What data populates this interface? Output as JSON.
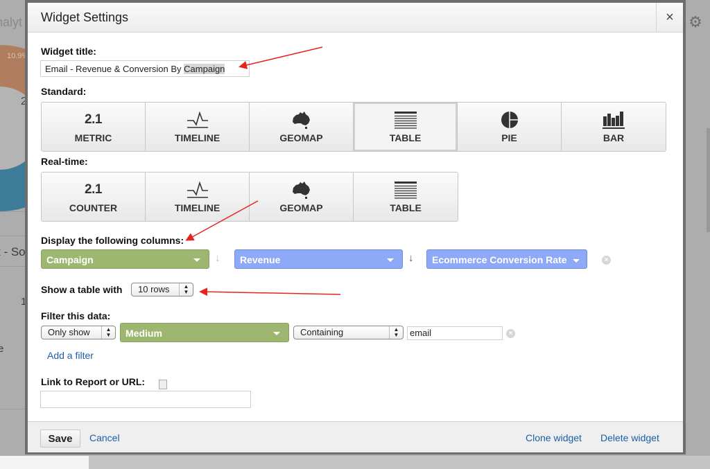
{
  "background": {
    "title_fragment": "nalyt",
    "pie_percent_label": "10.9%",
    "pie_center_fragment": "2",
    "row_text_fragment": "t - So",
    "row_value_fragment": "1",
    "row_text_fragment2": "e",
    "gear_icon": "gear-icon"
  },
  "modal": {
    "title": "Widget Settings",
    "close_icon": "×",
    "widget_title_label": "Widget title:",
    "widget_title_value_prefix": "Email - Revenue & Conversion By ",
    "widget_title_value_highlight": "Campaign",
    "standard_label": "Standard:",
    "standard_options": [
      {
        "icon": "2.1",
        "label": "METRIC",
        "selected": false
      },
      {
        "icon": "timeline-icon",
        "label": "TIMELINE",
        "selected": false
      },
      {
        "icon": "geomap-icon",
        "label": "GEOMAP",
        "selected": false
      },
      {
        "icon": "table-icon",
        "label": "TABLE",
        "selected": true
      },
      {
        "icon": "pie-icon",
        "label": "PIE",
        "selected": false
      },
      {
        "icon": "bar-icon",
        "label": "BAR",
        "selected": false
      }
    ],
    "realtime_label": "Real-time:",
    "realtime_options": [
      {
        "icon": "2.1",
        "label": "COUNTER"
      },
      {
        "icon": "timeline-icon",
        "label": "TIMELINE"
      },
      {
        "icon": "geomap-icon",
        "label": "GEOMAP"
      },
      {
        "icon": "table-icon",
        "label": "TABLE"
      }
    ],
    "columns_label": "Display the following columns:",
    "columns": [
      {
        "name": "Campaign",
        "type": "dimension",
        "color": "#9db771"
      },
      {
        "name": "Revenue",
        "type": "metric",
        "color": "#8ea9f5"
      },
      {
        "name": "Ecommerce Conversion Rate",
        "type": "metric",
        "color": "#8ea9f5"
      }
    ],
    "rows_label": "Show a table with",
    "rows_value": "10 rows",
    "filter_label": "Filter this data:",
    "filter": {
      "mode": "Only show",
      "dimension": "Medium",
      "match": "Containing",
      "value": "email"
    },
    "add_filter": "Add a filter",
    "link_label": "Link to Report or URL:",
    "link_value": "",
    "footer": {
      "save": "Save",
      "cancel": "Cancel",
      "clone": "Clone widget",
      "delete": "Delete widget"
    }
  },
  "colors": {
    "dimension_green": "#9db771",
    "metric_blue": "#8ea9f5",
    "link_blue": "#1a5fa6",
    "annotation_red": "#e8231f"
  }
}
